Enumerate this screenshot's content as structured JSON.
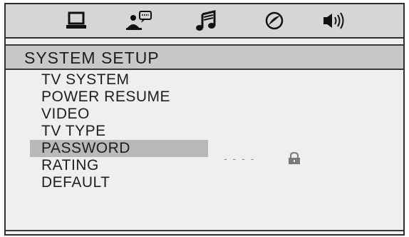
{
  "tabs": [
    {
      "name": "monitor-icon"
    },
    {
      "name": "person-speech-icon"
    },
    {
      "name": "music-note-icon"
    },
    {
      "name": "disc-icon"
    },
    {
      "name": "speaker-icon"
    }
  ],
  "colors": {
    "background": "#efefef",
    "tab_bar": "#d6d6d6",
    "title_bar": "#c8c8c8",
    "highlight": "#b9b9b9",
    "text": "#1e1e1e"
  },
  "page_title": "SYSTEM SETUP",
  "menu": {
    "items": [
      {
        "label": "TV SYSTEM"
      },
      {
        "label": "POWER RESUME"
      },
      {
        "label": "VIDEO"
      },
      {
        "label": "TV TYPE"
      },
      {
        "label": "PASSWORD"
      },
      {
        "label": "RATING"
      },
      {
        "label": "DEFAULT"
      }
    ],
    "selected_index": 4
  },
  "password_value": "- - - -",
  "password_status_icon": "padlock-icon"
}
